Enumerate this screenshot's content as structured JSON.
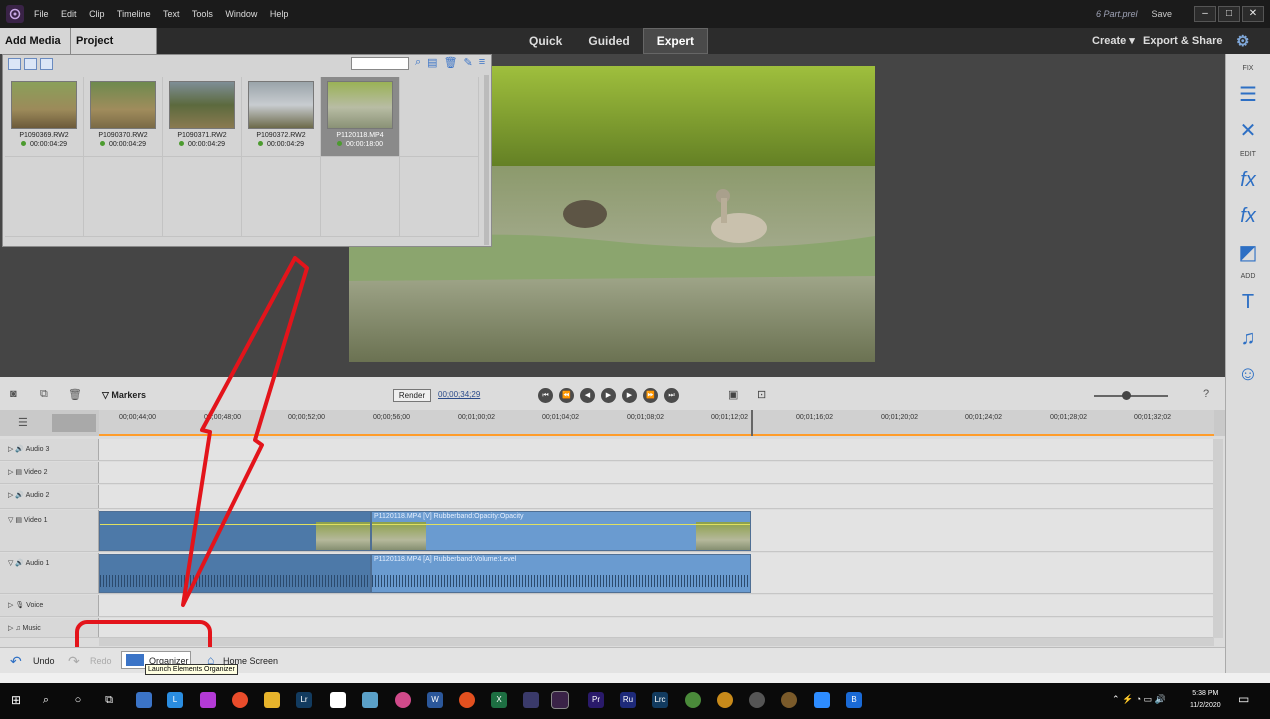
{
  "titlebar": {
    "menu": [
      "File",
      "Edit",
      "Clip",
      "Timeline",
      "Text",
      "Tools",
      "Window",
      "Help"
    ],
    "project_name": "6 Part.prel",
    "save_label": "Save"
  },
  "modebar": {
    "add_media": "Add Media",
    "project_assets": "Project Assets",
    "tabs": [
      "Quick",
      "Guided",
      "Expert"
    ],
    "active_tab": "Expert",
    "create": "Create",
    "export_share": "Export & Share"
  },
  "assets": {
    "items": [
      {
        "name": "P1090369.RW2",
        "duration": "00:00:04:29"
      },
      {
        "name": "P1090370.RW2",
        "duration": "00:00:04:29"
      },
      {
        "name": "P1090371.RW2",
        "duration": "00:00:04:29"
      },
      {
        "name": "P1090372.RW2",
        "duration": "00:00:04:29"
      },
      {
        "name": "P1120118.MP4",
        "duration": "00:00:18:00"
      }
    ]
  },
  "right_panel": {
    "fix_label": "FIX",
    "edit_label": "EDIT",
    "add_label": "ADD"
  },
  "timeline": {
    "markers_label": "Markers",
    "render_label": "Render",
    "timecode": "00;00;34;29",
    "ruler_ticks": [
      "00;00;44;00",
      "00;00;48;00",
      "00;00;52;00",
      "00;00;56;00",
      "00;01;00;02",
      "00;01;04;02",
      "00;01;08;02",
      "00;01;12;02",
      "00;01;16;02",
      "00;01;20;02",
      "00;01;24;02",
      "00;01;28;02",
      "00;01;32;02"
    ],
    "tracks": {
      "audio3": "Audio 3",
      "video2": "Video 2",
      "audio2": "Audio 2",
      "video1": "Video 1",
      "audio1": "Audio 1",
      "voice": "Voice",
      "music": "Music"
    },
    "video_clip_label": "P1120118.MP4 [V] Rubberband:Opacity:Opacity",
    "audio_clip_label": "P1120118.MP4 [A] Rubberband:Volume:Level"
  },
  "bottombar": {
    "undo": "Undo",
    "redo": "Redo",
    "organizer": "Organizer",
    "home_screen": "Home Screen",
    "tooltip": "Launch Elements Organizer"
  },
  "taskbar": {
    "time": "5:38 PM",
    "date": "11/2/2020"
  }
}
